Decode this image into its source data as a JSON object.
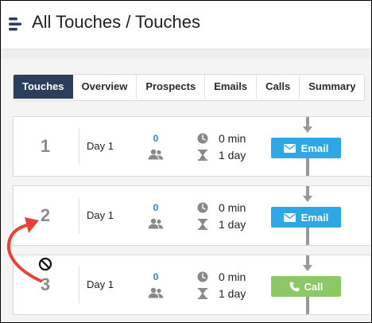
{
  "header": {
    "title": "All Touches / Touches",
    "logo_icon": "list-lines-icon"
  },
  "tabs": [
    {
      "label": "Touches",
      "active": true
    },
    {
      "label": "Overview",
      "active": false
    },
    {
      "label": "Prospects",
      "active": false
    },
    {
      "label": "Emails",
      "active": false
    },
    {
      "label": "Calls",
      "active": false
    },
    {
      "label": "Summary",
      "active": false
    }
  ],
  "touches": [
    {
      "number": "1",
      "day": "Day 1",
      "count": "0",
      "time": "0 min",
      "delay": "1 day",
      "action": "Email",
      "action_icon": "envelope-icon",
      "color": "#2ea8e5"
    },
    {
      "number": "2",
      "day": "Day 1",
      "count": "0",
      "time": "0 min",
      "delay": "1 day",
      "action": "Email",
      "action_icon": "envelope-icon",
      "color": "#2ea8e5"
    },
    {
      "number": "3",
      "day": "Day 1",
      "count": "0",
      "time": "0 min",
      "delay": "1 day",
      "action": "Call",
      "action_icon": "phone-icon",
      "color": "#8cc966"
    }
  ],
  "annotation": {
    "arrow_color": "#e8413a",
    "cursor_icon": "not-allowed-icon"
  }
}
